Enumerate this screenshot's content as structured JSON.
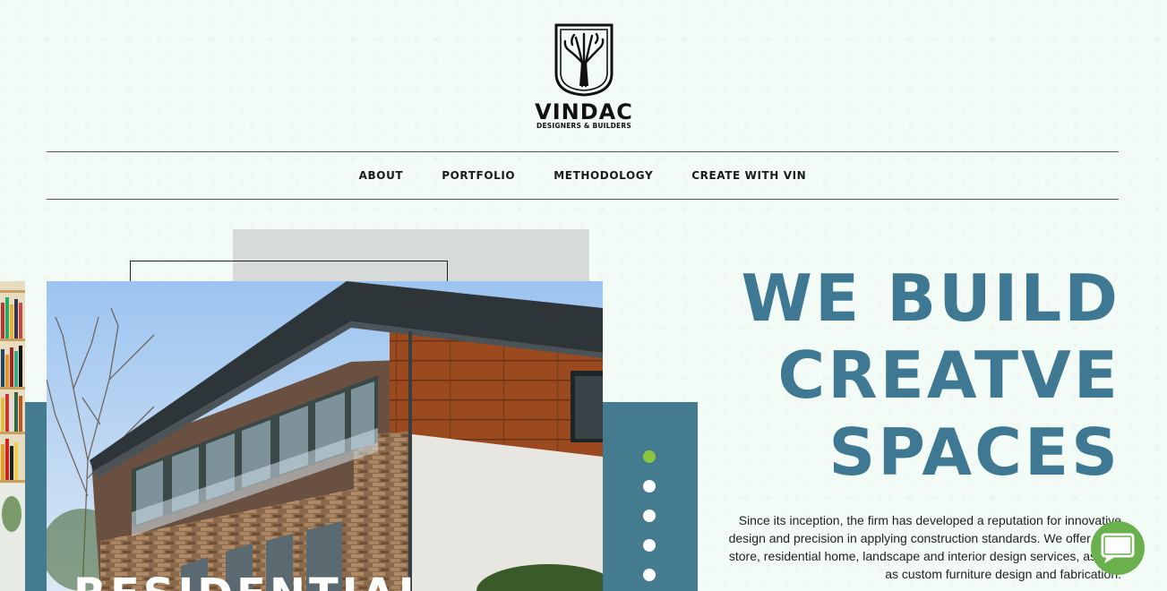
{
  "brand": {
    "name": "VINDAC",
    "tagline": "DESIGNERS & BUILDERS",
    "logo_icon": "tree-crest-icon"
  },
  "nav": {
    "items": [
      {
        "label": "ABOUT"
      },
      {
        "label": "PORTFOLIO"
      },
      {
        "label": "METHODOLOGY"
      },
      {
        "label": "CREATE WITH VIN"
      }
    ]
  },
  "hero": {
    "headline_lines": [
      "WE BUILD",
      "CREATVE",
      "SPACES"
    ],
    "intro": "Since its inception, the firm has developed a reputation for innovative design and precision in applying construction standards. We offer retail store, residential home, landscape and interior design services, as well as custom furniture design and fabrication.",
    "slide_title": "RESIDENTIAL",
    "slide_count": 5,
    "active_slide": 1
  },
  "colors": {
    "accent": "#3f7892",
    "teal_panel": "#457b8f",
    "active_dot": "#8cc63f",
    "chat_button": "#6ab04c",
    "background": "#f2fbf6"
  },
  "chat": {
    "icon": "chat-bubble-icon"
  }
}
